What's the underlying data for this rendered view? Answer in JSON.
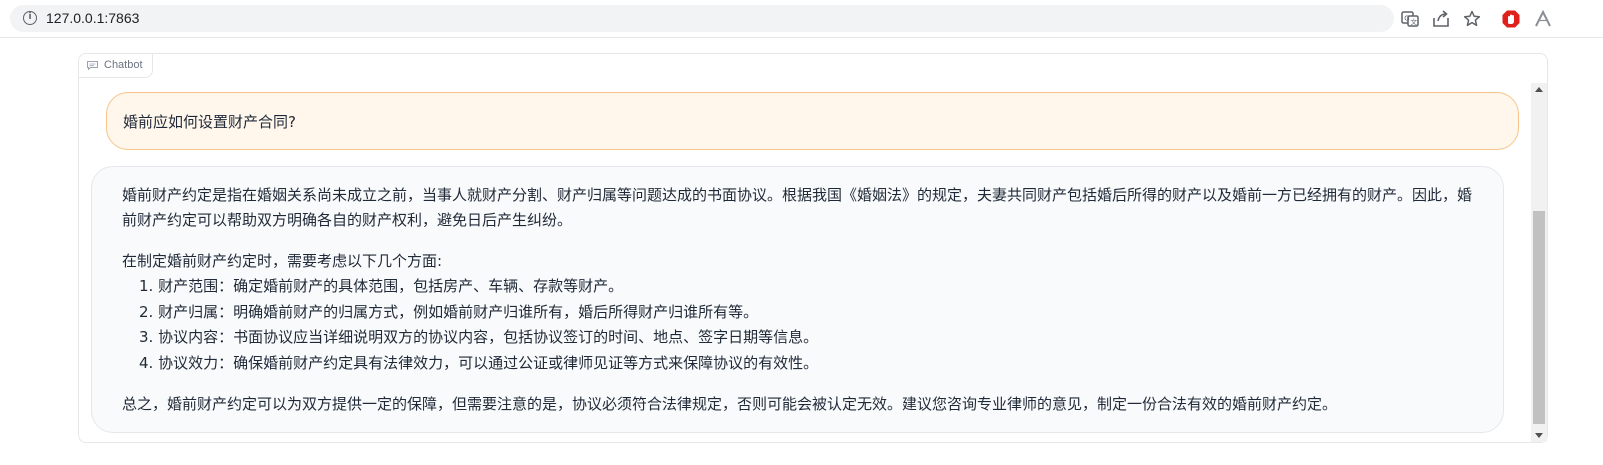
{
  "browser": {
    "url": "127.0.0.1:7863",
    "icons": [
      "info-icon",
      "translate-icon",
      "share-icon",
      "bookmark-star-icon",
      "extension-adblock-icon",
      "extension-a-icon"
    ]
  },
  "chatbot": {
    "label": "Chatbot",
    "messages": {
      "user": "婚前应如何设置财产合同?",
      "bot": {
        "intro": "婚前财产约定是指在婚姻关系尚未成立之前，当事人就财产分割、财产归属等问题达成的书面协议。根据我国《婚姻法》的规定，夫妻共同财产包括婚后所得的财产以及婚前一方已经拥有的财产。因此，婚前财产约定可以帮助双方明确各自的财产权利，避免日后产生纠纷。",
        "list_heading": "在制定婚前财产约定时，需要考虑以下几个方面:",
        "items": [
          "1. 财产范围：确定婚前财产的具体范围，包括房产、车辆、存款等财产。",
          "2. 财产归属：明确婚前财产的归属方式，例如婚前财产归谁所有，婚后所得财产归谁所有等。",
          "3. 协议内容：书面协议应当详细说明双方的协议内容，包括协议签订的时间、地点、签字日期等信息。",
          "4. 协议效力：确保婚前财产约定具有法律效力，可以通过公证或律师见证等方式来保障协议的有效性。"
        ],
        "conclusion": "总之，婚前财产约定可以为双方提供一定的保障，但需要注意的是，协议必须符合法律规定，否则可能会被认定无效。建议您咨询专业律师的意见，制定一份合法有效的婚前财产约定。"
      }
    }
  },
  "colors": {
    "user_bubble_bg": "#fff6ec",
    "user_bubble_border": "#f6c48b",
    "bot_bubble_bg": "#f9fafb",
    "adblock_red": "#e0201b"
  }
}
